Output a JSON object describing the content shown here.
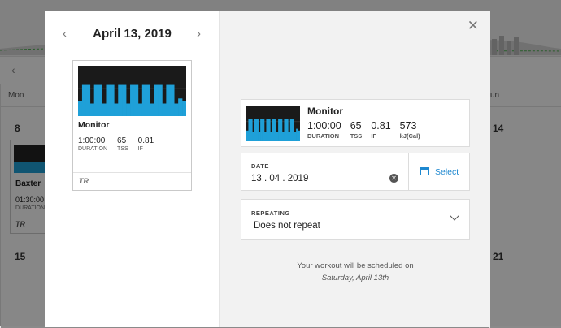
{
  "background": {
    "day_header": "Mon",
    "day_header_right": "un",
    "dates": [
      "8",
      "15",
      "14",
      "21"
    ],
    "card": {
      "name": "Baxter",
      "time": "01:30:00",
      "label": "DURATION",
      "logo": "TR"
    }
  },
  "modal": {
    "date_title": "April 13, 2019",
    "workout_card": {
      "name": "Monitor",
      "stats": [
        {
          "value": "1:00:00",
          "label": "DURATION"
        },
        {
          "value": "65",
          "label": "TSS"
        },
        {
          "value": "0.81",
          "label": "IF"
        }
      ],
      "logo": "TR"
    },
    "summary": {
      "name": "Monitor",
      "stats": [
        {
          "value": "1:00:00",
          "label": "DURATION"
        },
        {
          "value": "65",
          "label": "TSS"
        },
        {
          "value": "0.81",
          "label": "IF"
        },
        {
          "value": "573",
          "label": "kJ(Cal)"
        }
      ]
    },
    "date_field": {
      "label": "DATE",
      "value": "13 . 04 . 2019",
      "select_label": "Select"
    },
    "repeating_field": {
      "label": "REPEATING",
      "value": "Does not repeat"
    },
    "message": {
      "line1": "Your workout will be scheduled on",
      "line2": "Saturday, April 13th"
    }
  },
  "workout_profile": [
    0.3,
    0.62,
    0.62,
    0.25,
    0.62,
    0.62,
    0.25,
    0.62,
    0.62,
    0.25,
    0.62,
    0.62,
    0.25,
    0.62,
    0.62,
    0.25,
    0.62,
    0.62,
    0.25,
    0.62,
    0.62,
    0.25,
    0.62,
    0.62,
    0.25,
    0.35,
    0.3
  ],
  "colors": {
    "accent": "#1e88d0",
    "workout_blue": "#1fa0d8",
    "graph_bg": "#1a1a1a"
  }
}
